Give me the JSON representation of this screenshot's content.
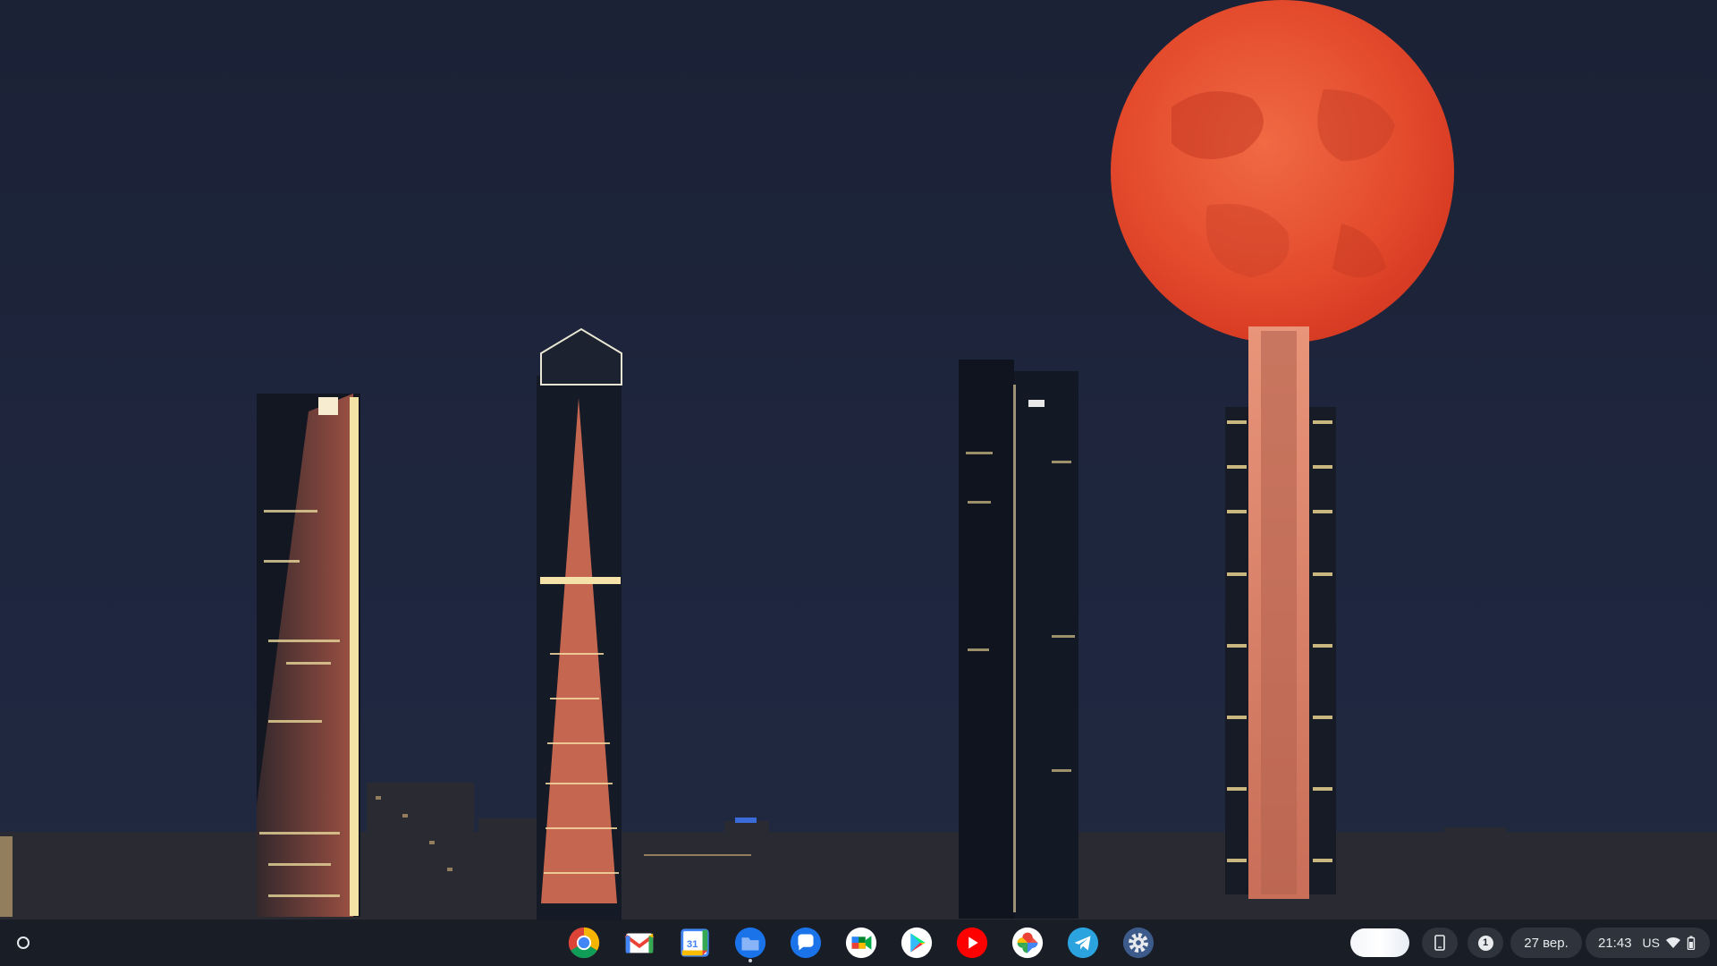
{
  "desktop": {
    "wallpaper": "night city skyline with red full moon"
  },
  "shelf": {
    "launcher_icon": "launcher-circle-icon",
    "apps": [
      {
        "name": "Chrome",
        "icon": "chrome-icon"
      },
      {
        "name": "Gmail",
        "icon": "gmail-icon"
      },
      {
        "name": "Calendar",
        "icon": "calendar-icon",
        "label": "31"
      },
      {
        "name": "Files",
        "icon": "files-icon",
        "running": true
      },
      {
        "name": "Messages",
        "icon": "messages-icon"
      },
      {
        "name": "Meet",
        "icon": "meet-icon"
      },
      {
        "name": "Play Store",
        "icon": "play-store-icon"
      },
      {
        "name": "YouTube",
        "icon": "youtube-icon"
      },
      {
        "name": "Photos",
        "icon": "photos-icon"
      },
      {
        "name": "Telegram",
        "icon": "telegram-icon"
      },
      {
        "name": "Settings",
        "icon": "settings-icon"
      }
    ]
  },
  "status": {
    "notification_count": "1",
    "date": "27 вер.",
    "time": "21:43",
    "input_method": "US",
    "wifi_icon": "wifi-icon",
    "battery_icon": "battery-icon",
    "phone_icon": "phone-hub-icon"
  },
  "colors": {
    "sky": "#1d2438",
    "moon": "#e0452c",
    "shelf": "#181c24"
  }
}
